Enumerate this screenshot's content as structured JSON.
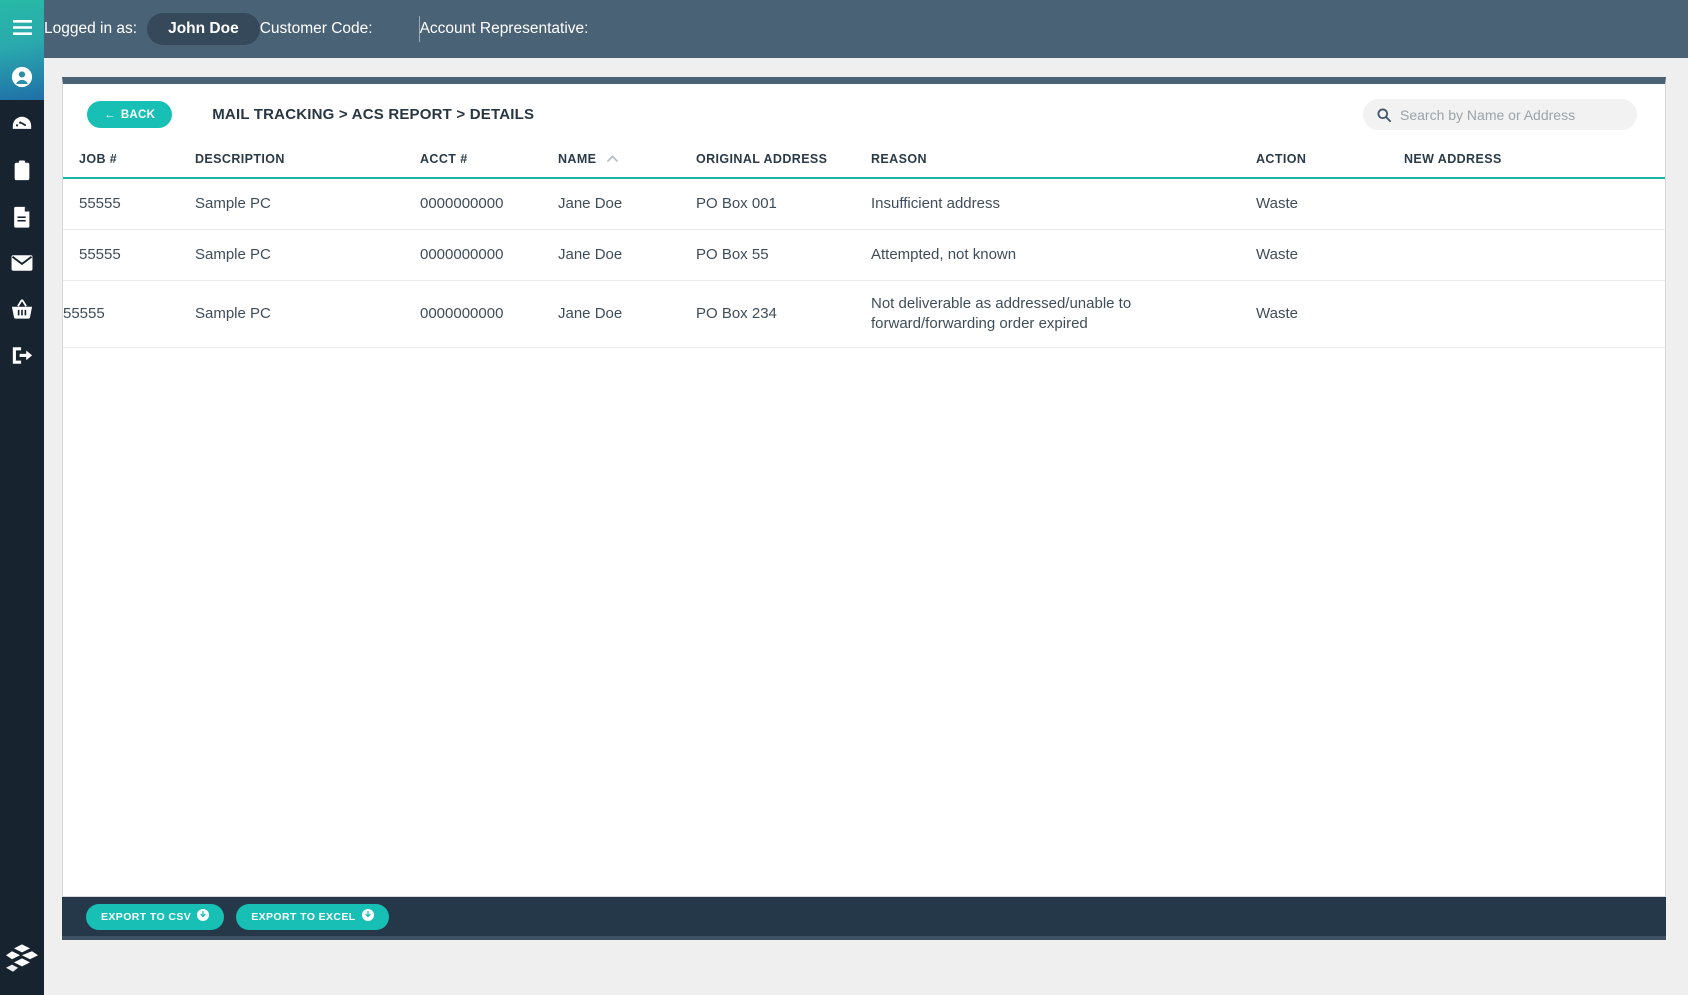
{
  "topbar": {
    "logged_in_label": "Logged in as:",
    "user_name": "John Doe",
    "customer_code_label": "Customer Code:",
    "account_rep_label": "Account Representative:"
  },
  "sidebar": {
    "items": [
      {
        "icon": "hamburger-menu-icon",
        "name": "menu-toggle"
      },
      {
        "icon": "user-circle-icon",
        "name": "sidebar-item-account"
      },
      {
        "icon": "gauge-dashboard-icon",
        "name": "sidebar-item-dashboard"
      },
      {
        "icon": "clipboard-icon",
        "name": "sidebar-item-jobs"
      },
      {
        "icon": "document-icon",
        "name": "sidebar-item-reports"
      },
      {
        "icon": "envelope-icon",
        "name": "sidebar-item-mail"
      },
      {
        "icon": "basket-icon",
        "name": "sidebar-item-orders"
      },
      {
        "icon": "logout-icon",
        "name": "sidebar-item-logout"
      }
    ],
    "logo_icon": "stacked-layers-logo"
  },
  "card": {
    "back_label": "BACK",
    "breadcrumb": "MAIL TRACKING > ACS REPORT > DETAILS",
    "search_placeholder": "Search by Name or Address",
    "search_value": ""
  },
  "table": {
    "columns": [
      "JOB #",
      "DESCRIPTION",
      "ACCT #",
      "NAME",
      "ORIGINAL ADDRESS",
      "REASON",
      "ACTION",
      "NEW ADDRESS"
    ],
    "sort_column": "NAME",
    "sort_direction": "ascending",
    "rows": [
      {
        "job": "55555",
        "description": "Sample PC",
        "acct": "0000000000",
        "name": "Jane Doe",
        "original_address": "PO Box 001",
        "reason": "Insufficient address",
        "action": "Waste",
        "new_address": ""
      },
      {
        "job": "55555",
        "description": "Sample PC",
        "acct": "0000000000",
        "name": "Jane Doe",
        "original_address": "PO Box 55",
        "reason": "Attempted, not known",
        "action": "Waste",
        "new_address": ""
      },
      {
        "job": "55555",
        "description": "Sample PC",
        "acct": "0000000000",
        "name": "Jane Doe",
        "original_address": "PO Box 234",
        "reason": "Not deliverable as addressed/unable to forward/forwarding order expired",
        "action": "Waste",
        "new_address": ""
      }
    ]
  },
  "footer": {
    "export_csv_label": "EXPORT TO CSV",
    "export_excel_label": "EXPORT TO EXCEL"
  },
  "colors": {
    "teal": "#18bfb4",
    "slate": "#4a6275",
    "navy": "#24384a",
    "sidebar": "#17242f"
  }
}
